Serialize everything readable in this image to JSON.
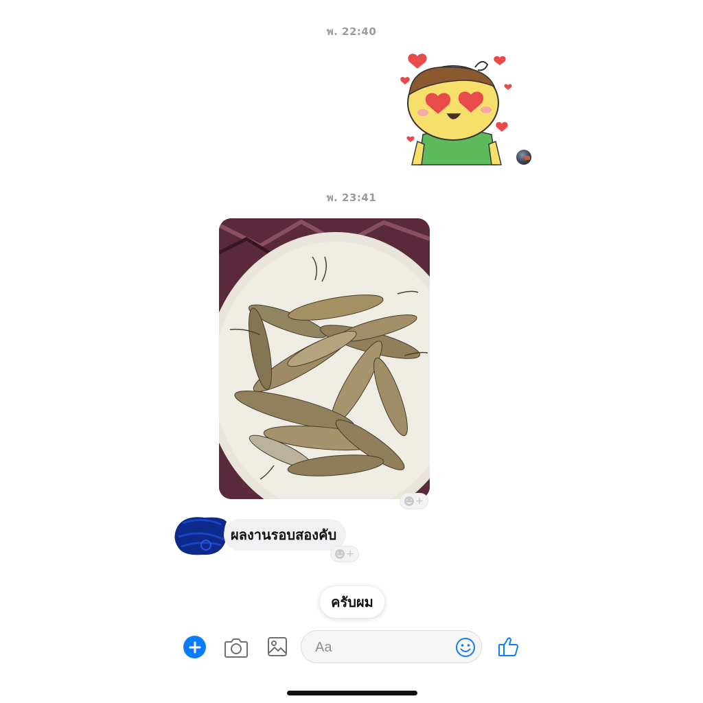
{
  "conversation": {
    "timestamp_1": "พ. 22:40",
    "timestamp_2": "พ. 23:41"
  },
  "messages": {
    "incoming_text": "ผลงานรอบสองคับ",
    "react_icon": "add-reaction-icon",
    "react_plus": "+"
  },
  "quick_reply": {
    "label": "ครับผม"
  },
  "composer": {
    "placeholder": "Aa"
  },
  "toolbar": {
    "icons": [
      "plus-icon",
      "camera-icon",
      "gallery-icon",
      "emoji-icon",
      "thumbs-up-icon"
    ]
  },
  "colors": {
    "accent": "#0a7cff",
    "bubble_bg": "#f1f1f3",
    "timestamp": "#9a9a9a"
  }
}
